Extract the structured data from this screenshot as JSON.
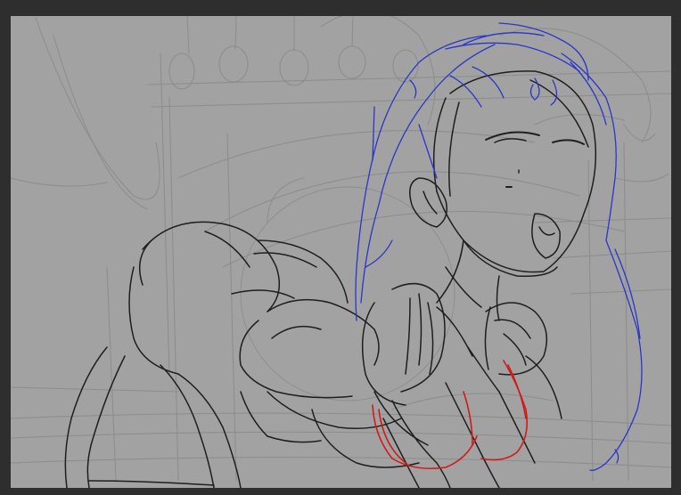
{
  "canvas": {
    "background_color": "#a2a2a2",
    "frame_color": "#2e2e2e",
    "layers": [
      {
        "name": "construction",
        "color": "#8c8c8c"
      },
      {
        "name": "lineart",
        "color": "#1e1e1e"
      },
      {
        "name": "hair",
        "color": "#2a36c8"
      },
      {
        "name": "accent",
        "color": "#d01a1a"
      }
    ]
  }
}
